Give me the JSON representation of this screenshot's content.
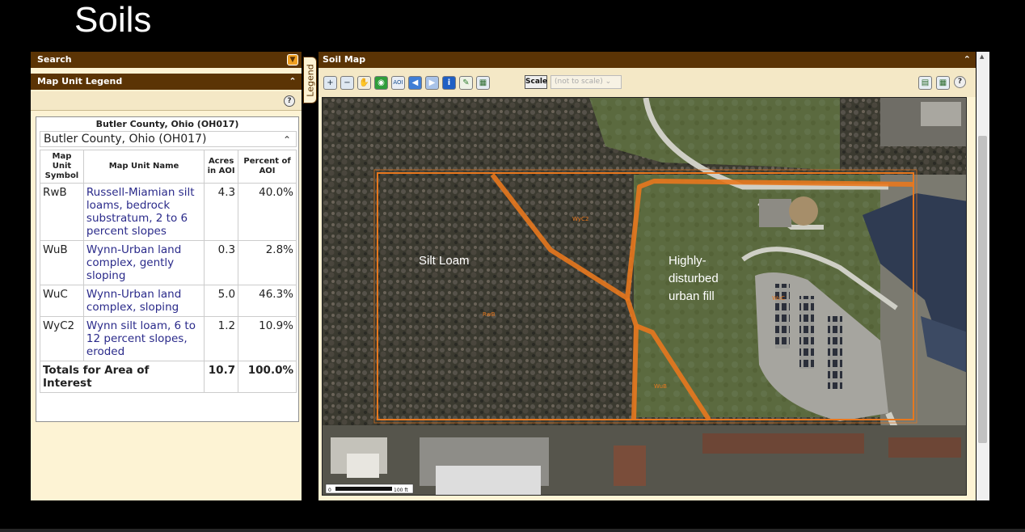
{
  "slide": {
    "title": "Soils"
  },
  "left_panel": {
    "search_bar": "Search",
    "legend_bar": "Map Unit Legend",
    "legend_box": {
      "header": "Butler County, Ohio (OH017)",
      "county_row": "Butler County, Ohio (OH017)",
      "columns": [
        "Map Unit Symbol",
        "Map Unit Name",
        "Acres in AOI",
        "Percent of AOI"
      ],
      "rows": [
        {
          "symbol": "RwB",
          "name": "Russell-Miamian silt loams, bedrock substratum, 2 to 6 percent slopes",
          "acres": "4.3",
          "percent": "40.0%"
        },
        {
          "symbol": "WuB",
          "name": "Wynn-Urban land complex, gently sloping",
          "acres": "0.3",
          "percent": "2.8%"
        },
        {
          "symbol": "WuC",
          "name": "Wynn-Urban land complex, sloping",
          "acres": "5.0",
          "percent": "46.3%"
        },
        {
          "symbol": "WyC2",
          "name": "Wynn silt loam, 6 to 12 percent slopes, eroded",
          "acres": "1.2",
          "percent": "10.9%"
        }
      ],
      "totals": {
        "label": "Totals for Area of Interest",
        "acres": "10.7",
        "percent": "100.0%"
      }
    }
  },
  "legend_tab": "Legend",
  "map_panel": {
    "title": "Soil Map",
    "scale_button": "Scale",
    "scale_select": "(not to scale)",
    "map_labels": {
      "silt_loam": "Silt Loam",
      "highly_disturbed_1": "Highly-",
      "highly_disturbed_2": "disturbed",
      "highly_disturbed_3": "urban fill",
      "unit_rwb": "RwB",
      "unit_wyc2": "WyC2",
      "unit_wuc": "WuC",
      "unit_wub": "WuB",
      "scalebar_zero": "0",
      "scalebar_end": "100 ft"
    },
    "tools": [
      "zoom-in-icon",
      "zoom-out-icon",
      "pan-icon",
      "full-extent-icon",
      "aoi-icon",
      "back-icon",
      "forward-icon",
      "identify-icon",
      "measure-icon",
      "print-icon"
    ]
  },
  "colors": {
    "panel_bar": "#5b3405",
    "panel_bg": "#fdf3d4",
    "aoi_outline": "#e8781e",
    "link": "#2a2a8a"
  }
}
